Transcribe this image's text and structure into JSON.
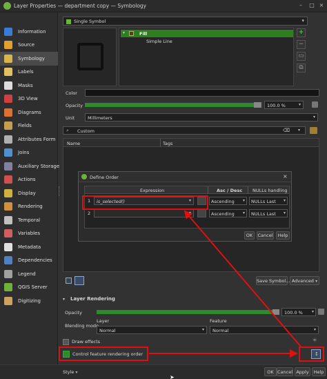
{
  "window": {
    "title": "Layer Properties — department copy — Symbology"
  },
  "sidebar": {
    "items": [
      {
        "label": "Information",
        "color": "#3a7bd5"
      },
      {
        "label": "Source",
        "color": "#e0a030"
      },
      {
        "label": "Symbology",
        "color": "#d9b44a",
        "active": true
      },
      {
        "label": "Labels",
        "color": "#e0c060"
      },
      {
        "label": "Masks",
        "color": "#dddddd"
      },
      {
        "label": "3D View",
        "color": "#d04040"
      },
      {
        "label": "Diagrams",
        "color": "#e07030"
      },
      {
        "label": "Fields",
        "color": "#c0a050"
      },
      {
        "label": "Attributes Form",
        "color": "#b0b0b0"
      },
      {
        "label": "Joins",
        "color": "#5090d0"
      },
      {
        "label": "Auxiliary Storage",
        "color": "#8080a0"
      },
      {
        "label": "Actions",
        "color": "#d05050"
      },
      {
        "label": "Display",
        "color": "#d0b040"
      },
      {
        "label": "Rendering",
        "color": "#d09040"
      },
      {
        "label": "Temporal",
        "color": "#c0c0c0"
      },
      {
        "label": "Variables",
        "color": "#d06060"
      },
      {
        "label": "Metadata",
        "color": "#e0e0e0"
      },
      {
        "label": "Dependencies",
        "color": "#5080c0"
      },
      {
        "label": "Legend",
        "color": "#a0a0a0"
      },
      {
        "label": "QGIS Server",
        "color": "#6fb23b"
      },
      {
        "label": "Digitizing",
        "color": "#d0a060"
      }
    ]
  },
  "symbology": {
    "renderer": "Single Symbol",
    "tree_fill": "Fill",
    "tree_line": "Simple Line",
    "color_label": "Color",
    "opacity_label": "Opacity",
    "opacity_value": "100.0 %",
    "unit_label": "Unit",
    "unit_value": "Millimeters",
    "search_value": "Custom",
    "col_name": "Name",
    "col_tags": "Tags",
    "save_symbol": "Save Symbol...",
    "advanced": "Advanced"
  },
  "layer_rendering": {
    "heading": "Layer Rendering",
    "opacity_label": "Opacity",
    "opacity_value": "100.0 %",
    "blending_label": "Blending mode",
    "layer_label": "Layer",
    "layer_value": "Normal",
    "feature_label": "Feature",
    "feature_value": "Normal",
    "draw_effects": "Draw effects",
    "control_order": "Control feature rendering order"
  },
  "define_order": {
    "title": "Define Order",
    "col_expression": "Expression",
    "col_ascdesc": "Asc / Desc",
    "col_nulls": "NULLs handling",
    "rows": [
      {
        "num": "1",
        "expression": "is_selected()",
        "order": "Ascending",
        "nulls": "NULLs Last"
      },
      {
        "num": "2",
        "expression": "",
        "order": "Ascending",
        "nulls": "NULLs Last"
      }
    ],
    "ok": "OK",
    "cancel": "Cancel",
    "help": "Help"
  },
  "footer": {
    "style": "Style",
    "ok": "OK",
    "cancel": "Cancel",
    "apply": "Apply",
    "help": "Help"
  },
  "accent_colors": {
    "green": "#2d8a2d",
    "highlight": "#e01010",
    "fill_node": "#2e7d1f"
  }
}
